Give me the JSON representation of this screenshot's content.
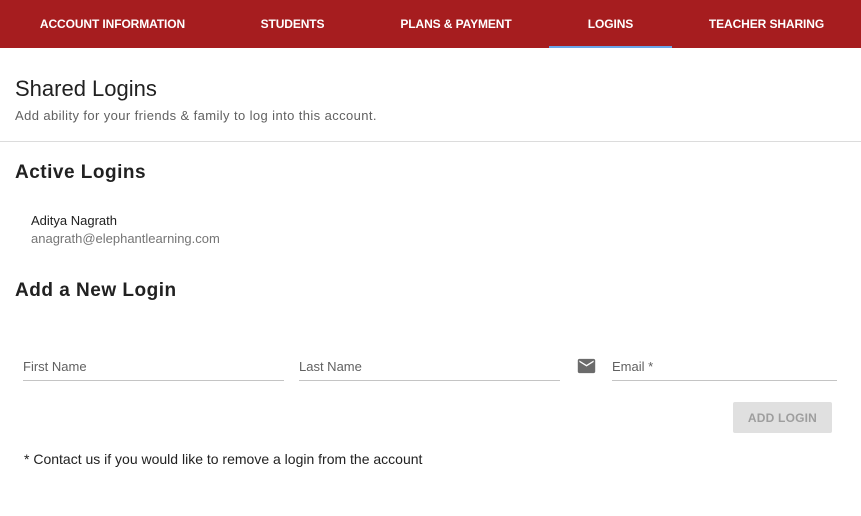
{
  "tabs": [
    {
      "label": "ACCOUNT INFORMATION",
      "active": false
    },
    {
      "label": "STUDENTS",
      "active": false
    },
    {
      "label": "PLANS & PAYMENT",
      "active": false
    },
    {
      "label": "LOGINS",
      "active": true
    },
    {
      "label": "TEACHER SHARING",
      "active": false
    }
  ],
  "colors": {
    "tabbar": "#a61d1f",
    "active_indicator": "#6aa5e8"
  },
  "header": {
    "title": "Shared Logins",
    "subtitle": "Add ability for your friends & family to log into this account."
  },
  "active_logins": {
    "heading": "Active Logins",
    "items": [
      {
        "name": "Aditya Nagrath",
        "email": "anagrath@elephantlearning.com"
      }
    ]
  },
  "new_login": {
    "heading": "Add a New Login",
    "first_name": {
      "placeholder": "First Name",
      "value": ""
    },
    "last_name": {
      "placeholder": "Last Name",
      "value": ""
    },
    "email": {
      "placeholder": "Email *",
      "value": "",
      "icon": "mail-icon"
    },
    "add_button": "ADD LOGIN"
  },
  "footnote": "* Contact us if you would like to remove a login from the account"
}
